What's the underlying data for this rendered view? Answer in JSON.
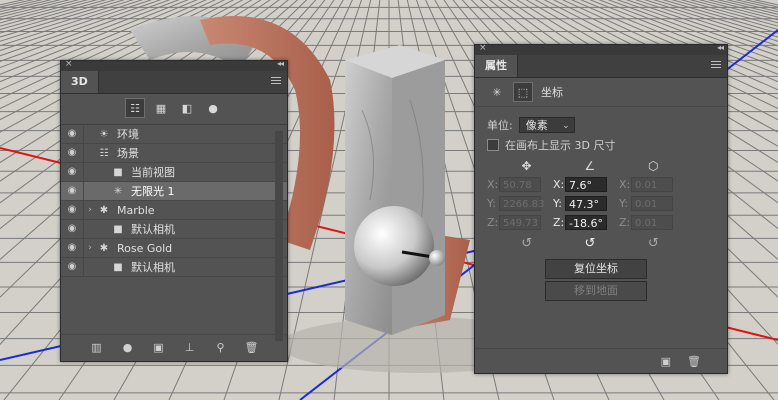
{
  "panel_3d": {
    "tab_label": "3D",
    "filter_icons": [
      "scene-filter-icon",
      "mesh-filter-icon",
      "material-filter-icon",
      "light-filter-icon"
    ],
    "layers": [
      {
        "label": "环境",
        "icon": "environment-icon",
        "expandable": false,
        "selected": false
      },
      {
        "label": "场景",
        "icon": "scene-icon",
        "expandable": false,
        "selected": false
      },
      {
        "label": "当前视图",
        "icon": "camera-icon",
        "expandable": false,
        "selected": false
      },
      {
        "label": "无限光 1",
        "icon": "infinite-light-icon",
        "expandable": false,
        "selected": true
      },
      {
        "label": "Marble",
        "icon": "mesh-icon",
        "expandable": true,
        "selected": false
      },
      {
        "label": "默认相机",
        "icon": "camera-icon",
        "expandable": false,
        "selected": false
      },
      {
        "label": "Rose Gold",
        "icon": "mesh-icon",
        "expandable": true,
        "selected": false
      },
      {
        "label": "默认相机",
        "icon": "camera-icon",
        "expandable": false,
        "selected": false
      }
    ],
    "bottom_icons": [
      "new-mesh-icon",
      "new-light-icon",
      "render-icon",
      "drop-to-ground-icon",
      "add-constraint-icon",
      "delete-icon"
    ]
  },
  "panel_properties": {
    "tab_label": "属性",
    "section_label": "坐标",
    "unit_label": "单位:",
    "unit_value": "像素",
    "show_dimensions_label": "在画布上显示 3D 尺寸",
    "position": {
      "x": "50.78",
      "y": "2266.83",
      "z": "549.73"
    },
    "rotation": {
      "x": "7.6°",
      "y": "47.3°",
      "z": "-18.6°"
    },
    "scale": {
      "x": "0.01",
      "y": "0.01",
      "z": "0.01"
    },
    "reset_button": "复位坐标",
    "move_to_ground_button": "移到地面"
  },
  "colors": {
    "panel_bg": "#535353",
    "rose_gold": "#b06a55",
    "axis_red": "#e11414",
    "axis_blue": "#1a2bd6"
  }
}
